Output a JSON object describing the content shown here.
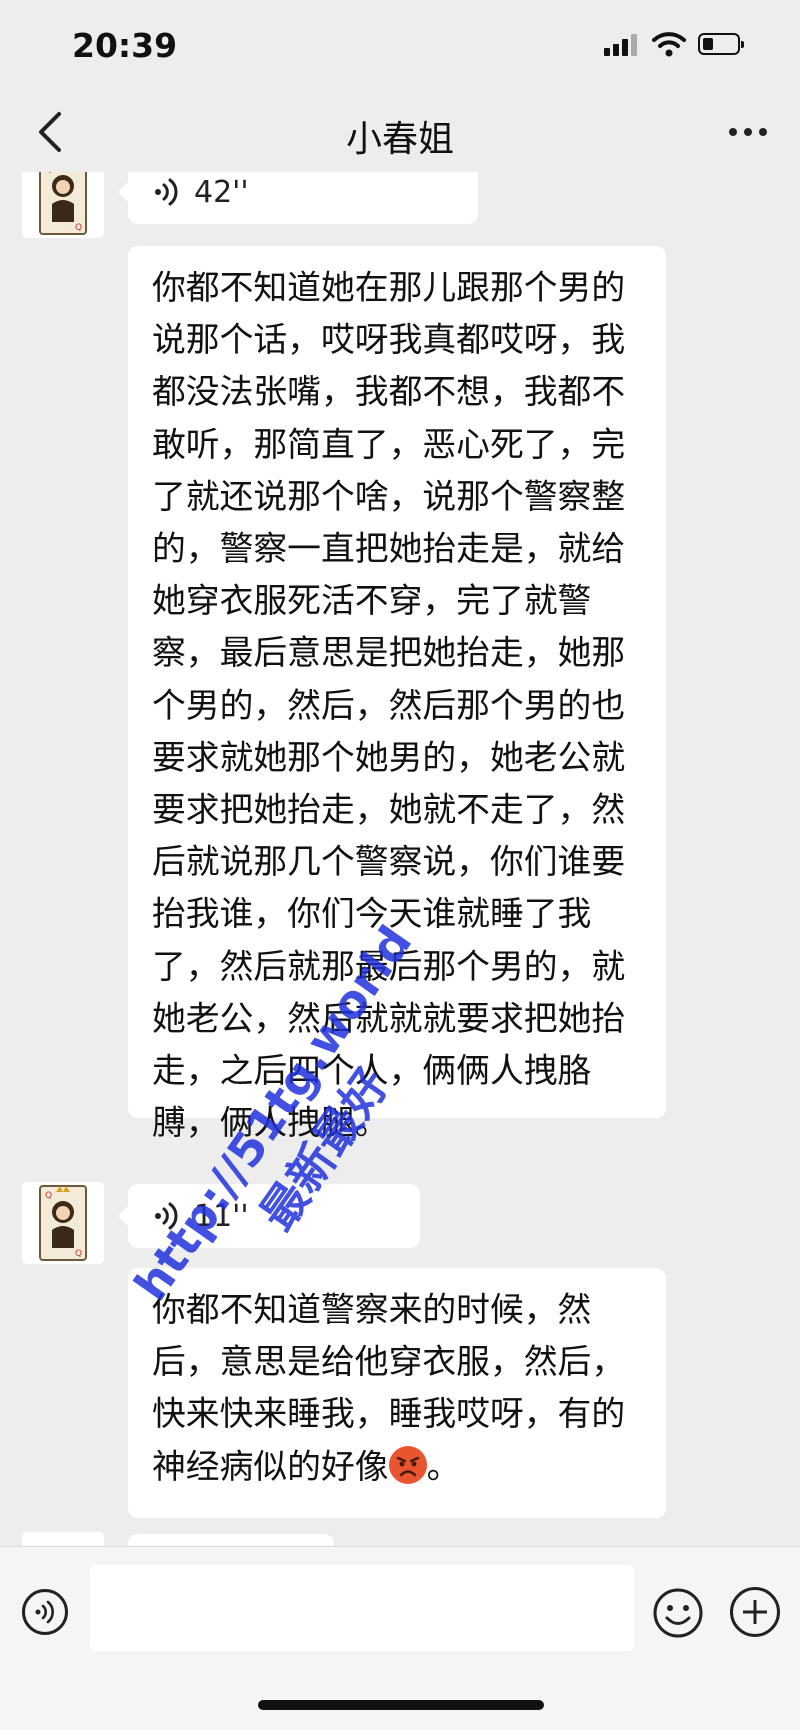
{
  "status": {
    "time": "20:39"
  },
  "header": {
    "title": "小春姐"
  },
  "messages": [
    {
      "type": "voice",
      "duration": "42''"
    },
    {
      "type": "text",
      "text": "你都不知道她在那儿跟那个男的说那个话，哎呀我真都哎呀，我都没法张嘴，我都不想，我都不敢听，那简直了，恶心死了，完了就还说那个啥，说那个警察整的，警察一直把她抬走是，就给她穿衣服死活不穿，完了就警察，最后意思是把她抬走，她那个男的，然后，然后那个男的也要求就她那个她男的，她老公就要求把她抬走，她就不走了，然后就说那几个警察说，你们谁要抬我谁，你们今天谁就睡了我了，然后就那最后那个男的，就她老公，然后就就就要求把她抬走，之后四个人，俩俩人拽胳膊，俩人拽腿。"
    },
    {
      "type": "voice",
      "duration": "11''"
    },
    {
      "type": "text",
      "text_before_emoji": "你都不知道警察来的时候，然后，意思是给他穿衣服，然后，快来快来睡我，睡我哎呀，有的神经病似的好像",
      "emoji": "angry-face",
      "text_after_emoji": "。"
    }
  ],
  "watermark": {
    "line1": "http://51tg.world",
    "line2": "最新最好"
  },
  "icons": {
    "back": "chevron-left-icon",
    "more": "more-dots-icon",
    "voice": "voice-wave-icon",
    "emoji": "smiley-icon",
    "plus": "plus-circle-icon"
  },
  "input": {
    "value": ""
  },
  "colors": {
    "chat_bg": "#ededed",
    "bubble_bg": "#ffffff",
    "input_bar_bg": "#f5f5f5",
    "watermark": "#2233dd"
  }
}
